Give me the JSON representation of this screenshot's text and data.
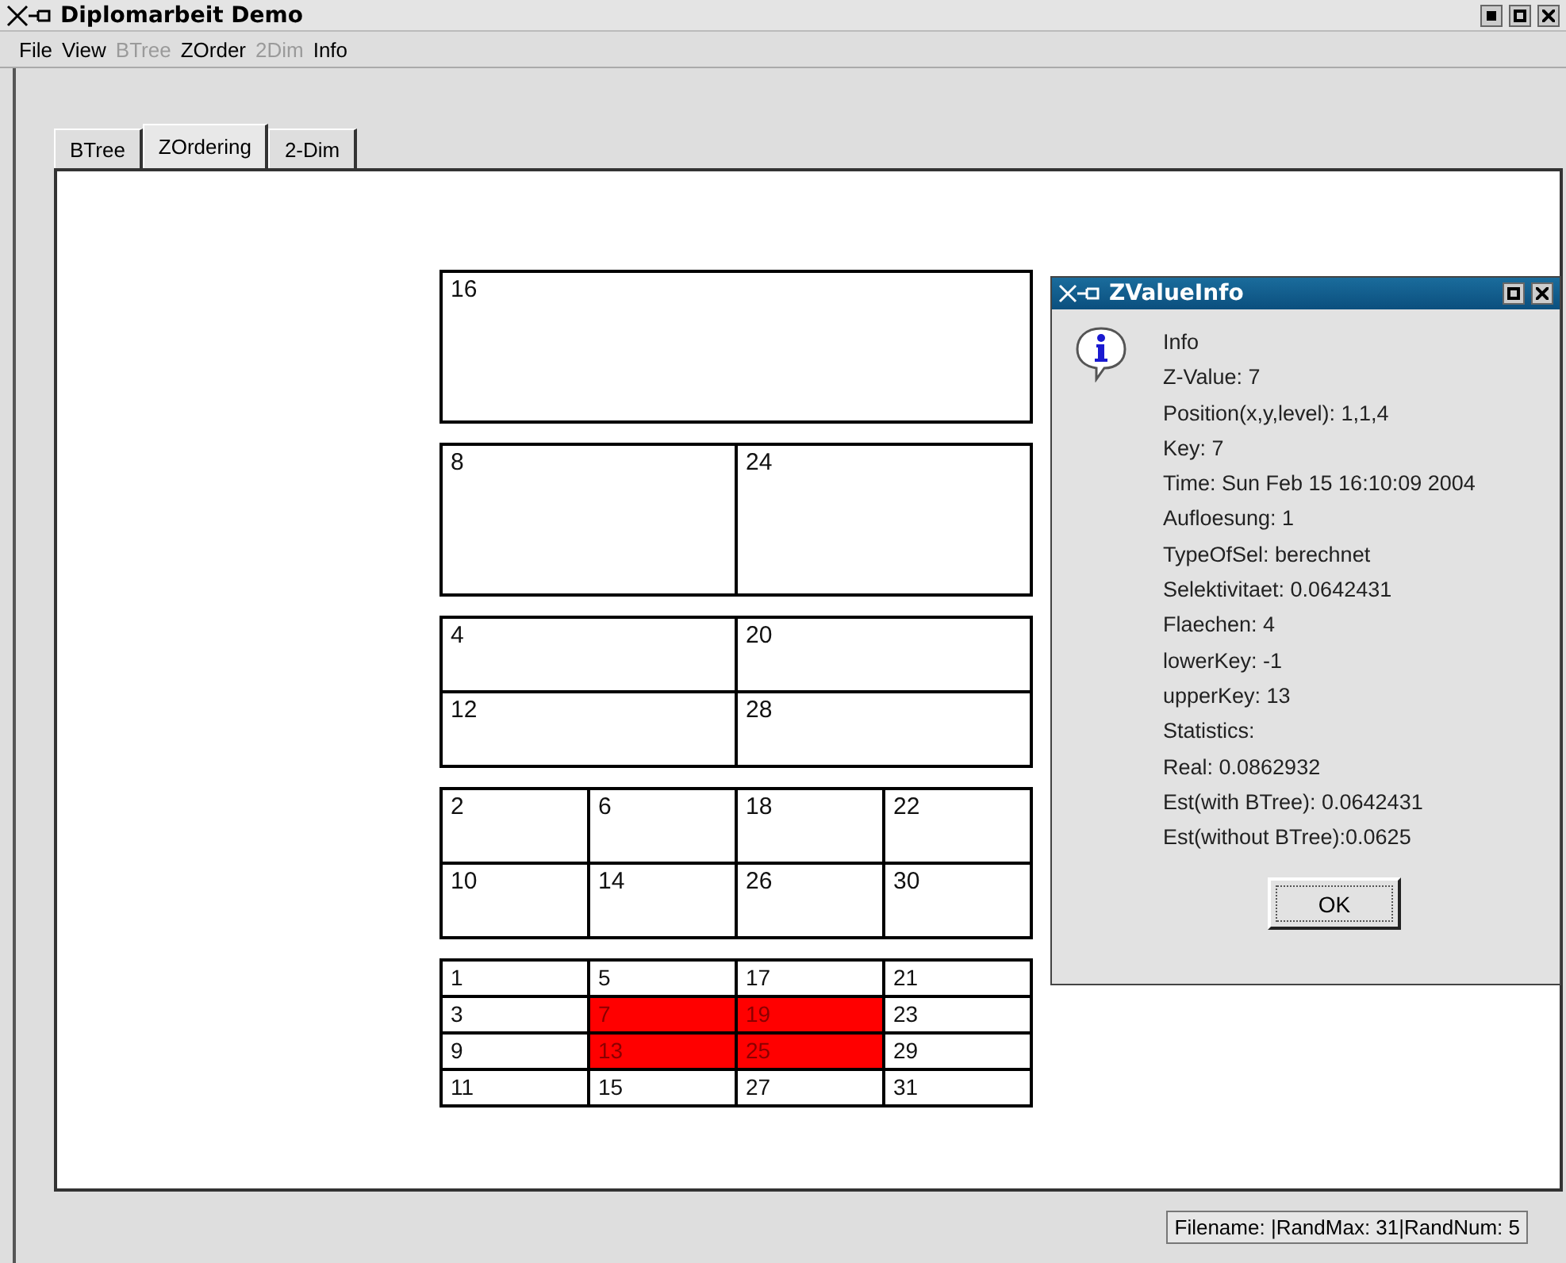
{
  "window": {
    "title": "Diplomarbeit Demo"
  },
  "menu": [
    {
      "label": "File",
      "disabled": false
    },
    {
      "label": "View",
      "disabled": false
    },
    {
      "label": "BTree",
      "disabled": true
    },
    {
      "label": "ZOrder",
      "disabled": false
    },
    {
      "label": "2Dim",
      "disabled": true
    },
    {
      "label": "Info",
      "disabled": false
    }
  ],
  "tabs": [
    {
      "label": "BTree",
      "selected": false
    },
    {
      "label": "ZOrdering",
      "selected": true
    },
    {
      "label": "2-Dim",
      "selected": false
    }
  ],
  "levels": [
    {
      "rows": [
        [
          {
            "label": "16",
            "highlighted": false
          }
        ]
      ]
    },
    {
      "rows": [
        [
          {
            "label": "8",
            "highlighted": false
          },
          {
            "label": "24",
            "highlighted": false
          }
        ]
      ]
    },
    {
      "rows": [
        [
          {
            "label": "4",
            "highlighted": false
          },
          {
            "label": "20",
            "highlighted": false
          }
        ],
        [
          {
            "label": "12",
            "highlighted": false
          },
          {
            "label": "28",
            "highlighted": false
          }
        ]
      ]
    },
    {
      "rows": [
        [
          {
            "label": "2",
            "highlighted": false
          },
          {
            "label": "6",
            "highlighted": false
          },
          {
            "label": "18",
            "highlighted": false
          },
          {
            "label": "22",
            "highlighted": false
          }
        ],
        [
          {
            "label": "10",
            "highlighted": false
          },
          {
            "label": "14",
            "highlighted": false
          },
          {
            "label": "26",
            "highlighted": false
          },
          {
            "label": "30",
            "highlighted": false
          }
        ]
      ]
    },
    {
      "rows": [
        [
          {
            "label": "1",
            "highlighted": false
          },
          {
            "label": "5",
            "highlighted": false
          },
          {
            "label": "17",
            "highlighted": false
          },
          {
            "label": "21",
            "highlighted": false
          }
        ],
        [
          {
            "label": "3",
            "highlighted": false
          },
          {
            "label": "7",
            "highlighted": true
          },
          {
            "label": "19",
            "highlighted": true
          },
          {
            "label": "23",
            "highlighted": false
          }
        ],
        [
          {
            "label": "9",
            "highlighted": false
          },
          {
            "label": "13",
            "highlighted": true
          },
          {
            "label": "25",
            "highlighted": true
          },
          {
            "label": "29",
            "highlighted": false
          }
        ],
        [
          {
            "label": "11",
            "highlighted": false
          },
          {
            "label": "15",
            "highlighted": false
          },
          {
            "label": "27",
            "highlighted": false
          },
          {
            "label": "31",
            "highlighted": false
          }
        ]
      ]
    }
  ],
  "dialog": {
    "title": "ZValueInfo",
    "lines": [
      "Info",
      "Z-Value: 7",
      "Position(x,y,level): 1,1,4",
      "Key: 7",
      "Time: Sun Feb 15 16:10:09 2004",
      "Aufloesung: 1",
      "TypeOfSel: berechnet",
      "Selektivitaet: 0.0642431",
      "Flaechen: 4",
      "lowerKey: -1",
      "upperKey: 13",
      "Statistics:",
      "Real: 0.0862932",
      "Est(with BTree): 0.0642431",
      "Est(without BTree):0.0625"
    ],
    "button": "OK"
  },
  "status_bar": "Filename: |RandMax: 31|RandNum: 5"
}
